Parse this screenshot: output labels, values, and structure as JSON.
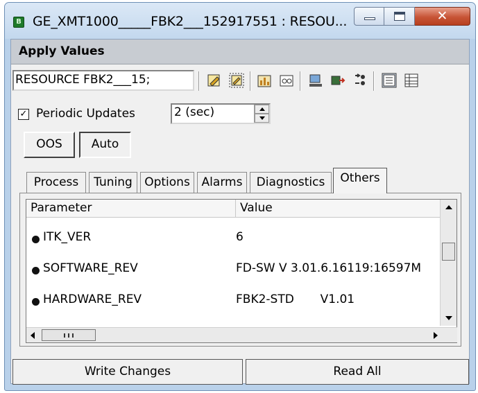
{
  "window": {
    "title": "GE_XMT1000_____FBK2___152917551 : RESOU...",
    "app_icon_letter": "B"
  },
  "menubar": {
    "apply_values": "Apply Values"
  },
  "toolbar": {
    "resource_field": "RESOURCE      FBK2___15;",
    "icons": [
      "edit-doc-icon",
      "edit-doc-selected-icon",
      "chart-icon",
      "glasses-icon",
      "device-download-icon",
      "device-upload-icon",
      "arrange-icon",
      "list-view-icon",
      "detail-view-icon"
    ]
  },
  "periodic": {
    "label": "Periodic Updates",
    "checked": true,
    "interval": "2 (sec)"
  },
  "mode_buttons": {
    "oos": "OOS",
    "auto": "Auto"
  },
  "tabs": [
    {
      "label": "Process"
    },
    {
      "label": "Tuning"
    },
    {
      "label": "Options"
    },
    {
      "label": "Alarms"
    },
    {
      "label": "Diagnostics"
    },
    {
      "label": "Others",
      "active": true
    }
  ],
  "list": {
    "columns": {
      "parameter": "Parameter",
      "value": "Value"
    },
    "rows": [
      {
        "name": "ITK_VER",
        "value": "6"
      },
      {
        "name": "SOFTWARE_REV",
        "value": "FD-SW V 3.01.6.16119:16597M"
      },
      {
        "name": "HARDWARE_REV",
        "value": "FBK2-STD       V1.01"
      }
    ]
  },
  "footer": {
    "write_changes": "Write Changes",
    "read_all": "Read All"
  },
  "colors": {
    "titlebar": "#c3d8ee",
    "close_button": "#c75436",
    "frame": "#b9d1ea"
  }
}
